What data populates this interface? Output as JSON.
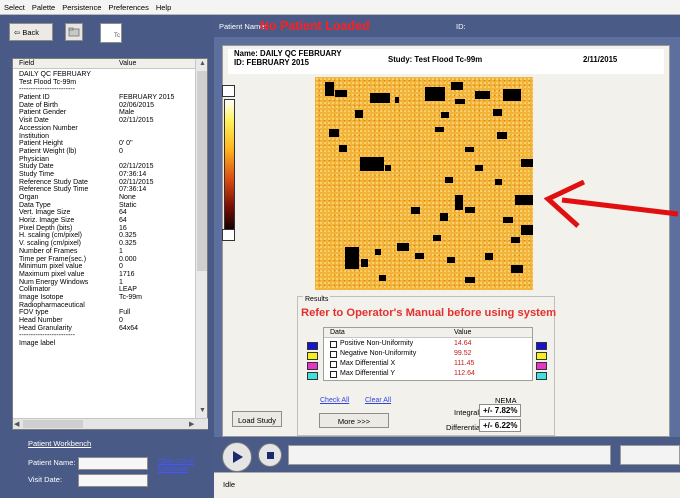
{
  "menu": [
    "Select",
    "Palette",
    "Persistence",
    "Preferences",
    "Help"
  ],
  "toolbar": {
    "back_label": "⇦ Back",
    "tab_label": "Tc"
  },
  "details": {
    "col_field": "Field",
    "col_value": "Value",
    "rows": [
      {
        "field": "DAILY QC FEBRUARY",
        "value": ""
      },
      {
        "field": "Test Flood Tc-99m",
        "value": ""
      },
      {
        "field": "------------------------",
        "value": ""
      },
      {
        "field": "Patient ID",
        "value": "FEBRUARY 2015"
      },
      {
        "field": "Date of Birth",
        "value": "02/06/2015"
      },
      {
        "field": "Patient Gender",
        "value": "Male"
      },
      {
        "field": "Visit Date",
        "value": "02/11/2015"
      },
      {
        "field": "Accession Number",
        "value": ""
      },
      {
        "field": "Institution",
        "value": ""
      },
      {
        "field": "Patient Height",
        "value": "0' 0\""
      },
      {
        "field": "Patient Weight (lb)",
        "value": "0"
      },
      {
        "field": "Physician",
        "value": ""
      },
      {
        "field": "Study Date",
        "value": "02/11/2015"
      },
      {
        "field": "Study Time",
        "value": "07:36:14"
      },
      {
        "field": "Reference Study Date",
        "value": "02/11/2015"
      },
      {
        "field": "Reference Study Time",
        "value": "07:36:14"
      },
      {
        "field": "Organ",
        "value": "None"
      },
      {
        "field": "Data Type",
        "value": "Static"
      },
      {
        "field": "Vert. Image Size",
        "value": "64"
      },
      {
        "field": "Horiz. Image Size",
        "value": "64"
      },
      {
        "field": "Pixel Depth (bits)",
        "value": "16"
      },
      {
        "field": "H. scaling (cm/pixel)",
        "value": "0.325"
      },
      {
        "field": "V. scaling (cm/pixel)",
        "value": "0.325"
      },
      {
        "field": "Number of Frames",
        "value": "1"
      },
      {
        "field": "Time per Frame(sec.)",
        "value": "0.000"
      },
      {
        "field": "Minimum pixel value",
        "value": "0"
      },
      {
        "field": "Maximum pixel value",
        "value": "1716"
      },
      {
        "field": "Num Energy Windows",
        "value": "1"
      },
      {
        "field": "Collimator",
        "value": "LEAP"
      },
      {
        "field": "Image Isotope",
        "value": "Tc-99m"
      },
      {
        "field": "Radiopharmaceutical",
        "value": ""
      },
      {
        "field": "FOV type",
        "value": "Full"
      },
      {
        "field": "Head Number",
        "value": "0"
      },
      {
        "field": "Head Granularity",
        "value": "64x64"
      },
      {
        "field": "------------------------",
        "value": ""
      },
      {
        "field": "Image label",
        "value": ""
      }
    ]
  },
  "workbench": {
    "title": "Patient Workbench",
    "patient_name_label": "Patient Name:",
    "visit_date_label": "Visit Date:",
    "open_db_line1": "Open Local",
    "open_db_line2": "Database"
  },
  "patient": {
    "name_label": "Patient Name:",
    "name_value": "No Patient Loaded",
    "id_label": "ID:"
  },
  "study_header": {
    "name_line": "Name: DAILY QC FEBRUARY",
    "id_line": "ID:  FEBRUARY 2015",
    "study": "Study: Test Flood Tc-99m",
    "date": "2/11/2015"
  },
  "results": {
    "label": "Results",
    "warning": "Refer to Operator's Manual before using system",
    "col_data": "Data",
    "col_value": "Value",
    "rows": [
      {
        "label": "Positive Non-Uniformity",
        "value": "14.64",
        "color": "#1414cc"
      },
      {
        "label": "Negative Non-Uniformity",
        "value": "99.52",
        "color": "#f5ef1e"
      },
      {
        "label": "Max Differential X",
        "value": "111.45",
        "color": "#e636c8"
      },
      {
        "label": "Max Differential Y",
        "value": "112.64",
        "color": "#3ee0e0"
      }
    ],
    "check_all": "Check All",
    "clear_all": "Clear All",
    "more": "More >>>",
    "load_study": "Load Study",
    "nema_label": "NEMA",
    "integral_label": "Integral",
    "integral_value": "+/- 7.82%",
    "differential_label": "Differential",
    "differential_value": "+/- 6.22%"
  },
  "status": {
    "text": "Idle"
  },
  "colors": {
    "warning": "#e53030",
    "patient_not_loaded": "#ff1f1f",
    "arrow": "#e01010",
    "link": "#3344dd"
  }
}
